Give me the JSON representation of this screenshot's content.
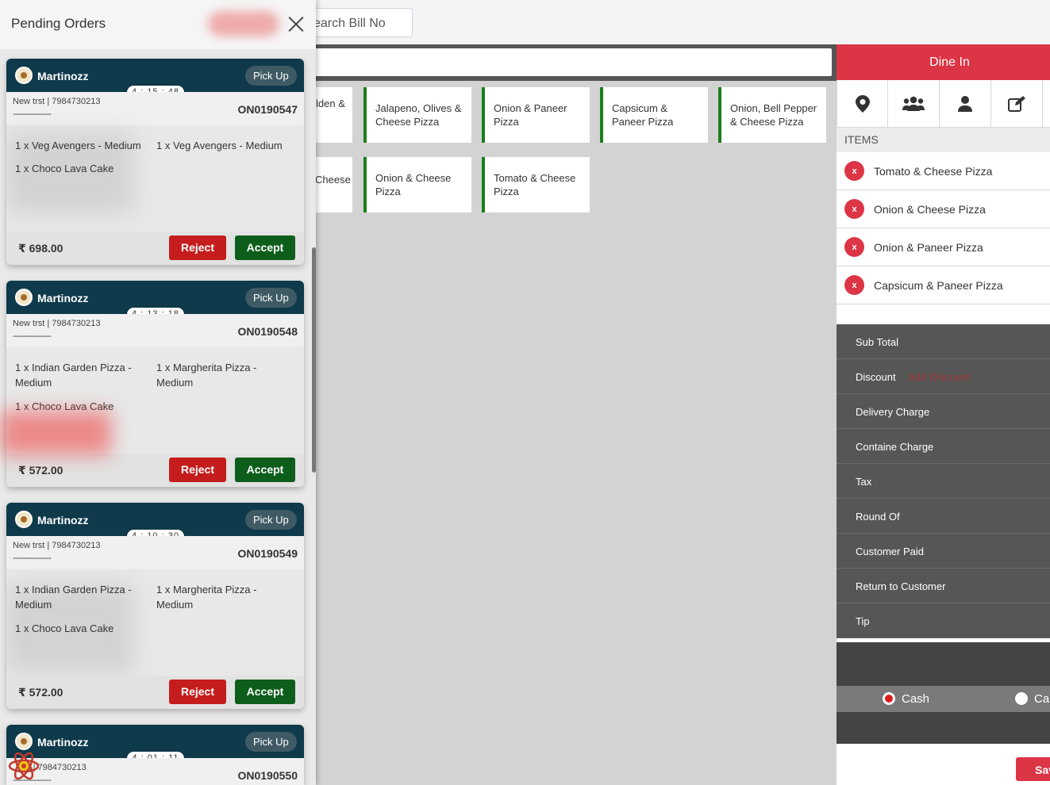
{
  "search_bill": {
    "placeholder": "earch Bill No"
  },
  "menu_items": [
    "lden &",
    "Jalapeno, Olives & Cheese Pizza",
    "Onion & Paneer Pizza",
    "Capsicum & Paneer Pizza",
    "Onion, Bell Pepper & Cheese Pizza",
    "Cheese",
    "Onion & Cheese Pizza",
    "Tomato & Cheese Pizza"
  ],
  "right_panel": {
    "order_type": "Dine In",
    "icons": [
      "location-icon",
      "group-icon",
      "user-icon",
      "edit-icon"
    ],
    "items_header": "ITEMS",
    "cart_items": [
      "Tomato & Cheese Pizza",
      "Onion & Cheese Pizza",
      "Onion & Paneer Pizza",
      "Capsicum & Paneer Pizza"
    ],
    "remove_label": "x",
    "totals": [
      "Sub Total",
      "Discount",
      "Delivery Charge",
      "Containe Charge",
      "Tax",
      "Round Of",
      "Customer Paid",
      "Return to Customer",
      "Tip"
    ],
    "add_discount": "Add Discount",
    "payment_methods": [
      "Cash",
      "Ca"
    ],
    "selected_payment": "Cash",
    "save_label": "Sav"
  },
  "drawer": {
    "title": "Pending Orders",
    "orders": [
      {
        "brand": "Martinozz",
        "type": "Pick Up",
        "timer": "4 : 15 : 48",
        "customer": "New trst | 7984730213",
        "dashes": "------------------",
        "order_no": "ON0190547",
        "items": [
          "1 x Veg Avengers - Medium",
          "1 x Veg Avengers - Medium",
          "1 x Choco Lava Cake"
        ],
        "total": "₹ 698.00",
        "reject": "Reject",
        "accept": "Accept"
      },
      {
        "brand": "Martinozz",
        "type": "Pick Up",
        "timer": "4 : 13 : 18",
        "customer": "New trst | 7984730213",
        "dashes": "------------------",
        "order_no": "ON0190548",
        "items": [
          "1 x Indian Garden Pizza - Medium",
          "1 x Margherita Pizza - Medium",
          "1 x Choco Lava Cake"
        ],
        "total": "₹ 572.00",
        "reject": "Reject",
        "accept": "Accept"
      },
      {
        "brand": "Martinozz",
        "type": "Pick Up",
        "timer": "4 : 10 : 30",
        "customer": "New trst | 7984730213",
        "dashes": "------------------",
        "order_no": "ON0190549",
        "items": [
          "1 x Indian Garden Pizza - Medium",
          "1 x Margherita Pizza - Medium",
          "1 x Choco Lava Cake"
        ],
        "total": "₹ 572.00",
        "reject": "Reject",
        "accept": "Accept"
      },
      {
        "brand": "Martinozz",
        "type": "Pick Up",
        "timer": "4 : 01 : 11",
        "customer": "st | 7984730213",
        "dashes": "------------------",
        "order_no": "ON0190550"
      }
    ]
  },
  "colors": {
    "accent_red": "#dc3545",
    "card_header": "#0e3a4b",
    "accept_green": "#0d5e1b",
    "reject_red": "#c51d1d",
    "tile_border": "#1b7f1b"
  }
}
